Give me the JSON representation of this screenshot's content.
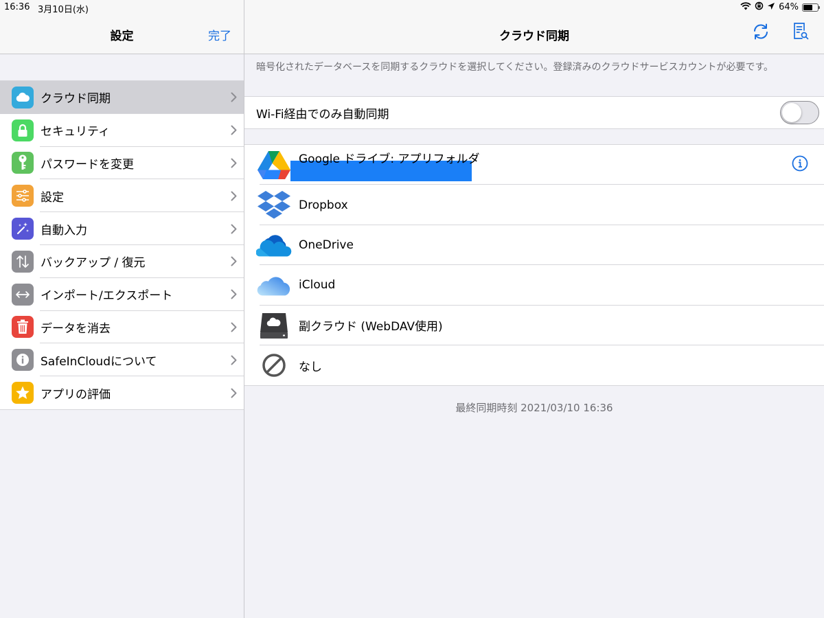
{
  "status": {
    "time": "16:36",
    "date": "3月10日(水)",
    "battery_text": "64%",
    "battery_level": 0.64
  },
  "sidebar": {
    "title": "設定",
    "done_label": "完了",
    "items": [
      {
        "label": "クラウド同期",
        "icon": "cloud-icon",
        "color": "#34aadc",
        "selected": true
      },
      {
        "label": "セキュリティ",
        "icon": "lock-icon",
        "color": "#4cd964"
      },
      {
        "label": "パスワードを変更",
        "icon": "key-icon",
        "color": "#5fc25e"
      },
      {
        "label": "設定",
        "icon": "sliders-icon",
        "color": "#f2a33a"
      },
      {
        "label": "自動入力",
        "icon": "magic-wand-icon",
        "color": "#5856d6"
      },
      {
        "label": "バックアップ / 復元",
        "icon": "up-down-arrows-icon",
        "color": "#8e8e93"
      },
      {
        "label": "インポート/エクスポート",
        "icon": "left-right-arrows-icon",
        "color": "#8e8e93"
      },
      {
        "label": "データを消去",
        "icon": "trash-icon",
        "color": "#e8453c"
      },
      {
        "label": "SafeInCloudについて",
        "icon": "info-icon",
        "color": "#8e8e93"
      },
      {
        "label": "アプリの評価",
        "icon": "star-icon",
        "color": "#f7b500"
      }
    ]
  },
  "main": {
    "title": "クラウド同期",
    "description": "暗号化されたデータベースを同期するクラウドを選択してください。登録済みのクラウドサービスカウントが必要です。",
    "wifi_label": "Wi-Fi経由でのみ自動同期",
    "wifi_enabled": false,
    "clouds": [
      {
        "label": "Google ドライブ: アプリフォルダ",
        "icon": "google-drive-icon"
      },
      {
        "label": "Dropbox",
        "icon": "dropbox-icon"
      },
      {
        "label": "OneDrive",
        "icon": "onedrive-icon"
      },
      {
        "label": "iCloud",
        "icon": "icloud-icon"
      },
      {
        "label": "副クラウド (WebDAV使用)",
        "icon": "webdav-server-icon"
      },
      {
        "label": "なし",
        "icon": "none-icon"
      }
    ],
    "last_sync": "最終同期時刻 2021/03/10 16:36"
  },
  "colors": {
    "accent": "#1a6fe0",
    "redaction": "#1a7ff7"
  }
}
